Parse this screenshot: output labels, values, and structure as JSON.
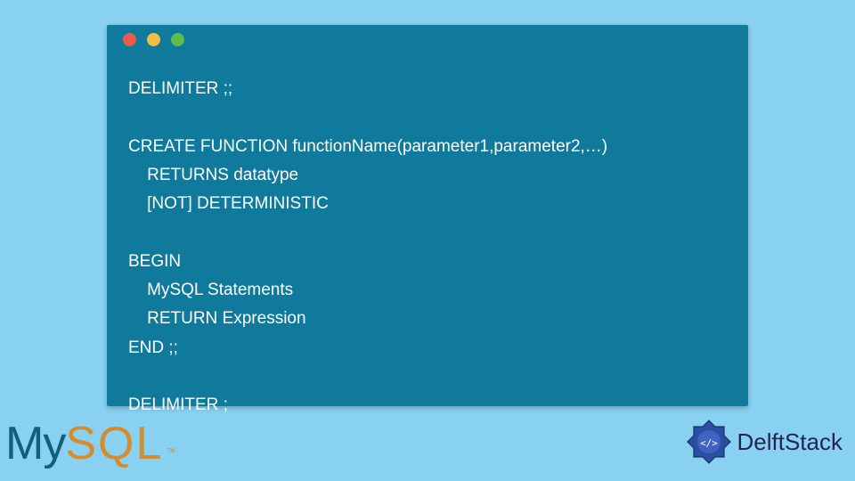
{
  "window": {
    "dots": [
      "red",
      "yellow",
      "green"
    ]
  },
  "code": {
    "l1": "DELIMITER ;;",
    "l2": "",
    "l3": "CREATE FUNCTION functionName(parameter1,parameter2,…)",
    "l4": "    RETURNS datatype",
    "l5": "    [NOT] DETERMINISTIC",
    "l6": "",
    "l7": "BEGIN",
    "l8": "    MySQL Statements",
    "l9": "    RETURN Expression",
    "l10": "END ;;",
    "l11": "",
    "l12": "DELIMITER ;"
  },
  "logos": {
    "mysql": {
      "part1": "My",
      "part2": "SQL",
      "tm": "™"
    },
    "delftstack": {
      "text": "DelftStack"
    }
  }
}
